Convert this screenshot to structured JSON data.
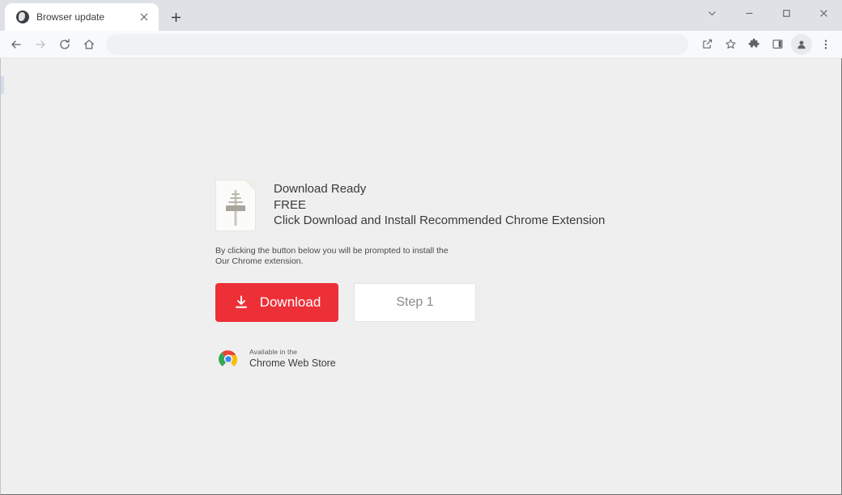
{
  "window": {
    "controls": {
      "tab_search_label": "Search tabs",
      "minimize_label": "Minimize",
      "maximize_label": "Maximize",
      "close_label": "Close"
    }
  },
  "tabstrip": {
    "tabs": [
      {
        "title": "Browser update",
        "favicon": "globe-icon",
        "close_label": "Close tab"
      }
    ],
    "new_tab_label": "New tab"
  },
  "toolbar": {
    "back_label": "Back",
    "forward_label": "Forward",
    "reload_label": "Reload",
    "home_label": "Home",
    "omnibox_value": "",
    "omnibox_placeholder": "",
    "share_label": "Share this page",
    "bookmark_label": "Bookmark this tab",
    "extensions_label": "Extensions",
    "side_panel_label": "Side panel",
    "profile_label": "Profile",
    "menu_label": "Customize and control Google Chrome"
  },
  "page": {
    "hero": {
      "icon": "document-installer-icon",
      "lines": [
        "Download Ready",
        "FREE",
        "Click Download and Install Recommended Chrome Extension"
      ]
    },
    "subnote_line_1": "By clicking the button below you will be prompted to install the",
    "subnote_line_2": "Our Chrome extension.",
    "buttons": {
      "download_label": "Download",
      "download_icon": "download-arrow-icon",
      "step_label": "Step 1"
    },
    "badge": {
      "logo": "chrome-logo-icon",
      "small_text": "Available in the",
      "big_text": "Chrome Web Store"
    }
  },
  "colors": {
    "download_red": "#ed3038",
    "page_background": "#efefef",
    "tabstrip_background": "#dee1e6",
    "toolbar_background": "#f8f9fa",
    "chrome_red": "#ea4335",
    "chrome_yellow": "#fbbc05",
    "chrome_green": "#34a853",
    "chrome_blue": "#4285f4"
  }
}
